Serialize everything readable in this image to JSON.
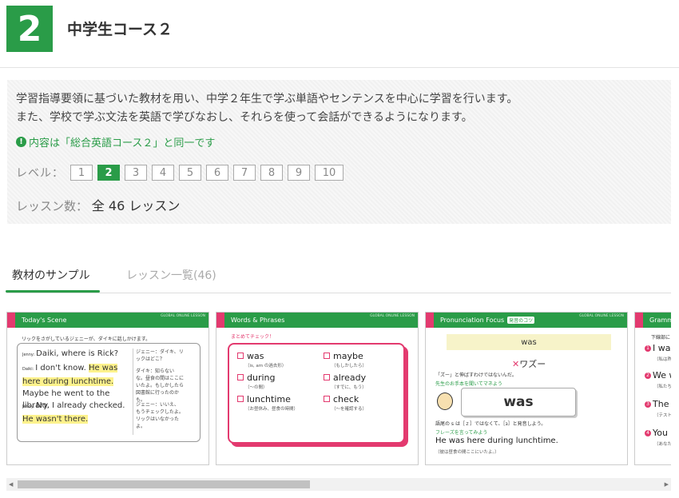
{
  "header": {
    "number": "2",
    "title": "中学生コース２"
  },
  "info": {
    "description_lines": [
      "学習指導要領に基づいた教材を用い、中学２年生で学ぶ単語やセンテンスを中心に学習を行います。",
      "また、学校で学ぶ文法を英語で学びなおし、それらを使って会話ができるようになります。"
    ],
    "note_icon": "!",
    "note": "内容は「総合英語コース２」と同一です",
    "level_label": "レベル：",
    "levels": [
      "1",
      "2",
      "3",
      "4",
      "5",
      "6",
      "7",
      "8",
      "9",
      "10"
    ],
    "active_level": "2",
    "lesson_label": "レッスン数：",
    "lesson_value": "全 46 レッスン"
  },
  "tabs": {
    "sample": "教材のサンプル",
    "list": "レッスン一覧(46)"
  },
  "cards": {
    "logo_text": "GLOBAL ONLINE LESSON",
    "scene": {
      "title": "Today's Scene",
      "hint": "リックをさがしているジェニーが、ダイキに話しかけます。",
      "speaker_jenny": "Jenny:",
      "speaker_daiki": "Daiki:",
      "line1": "Daiki, where is Rick?",
      "line2a": "I don't know.",
      "line2b": "He was here during lunchtime.",
      "line2c": "Maybe he went to the library.",
      "line3a": "No, I already checked.",
      "line3b": "He wasn't there.",
      "jp1_speaker": "ジェニー：",
      "jp1": "ダイキ、リックはどこ？",
      "jp2_speaker": "ダイキ：",
      "jp2": "知らないな。昼食の間はここにいたよ。もしかしたら図書館に行ったのかも。",
      "jp3_speaker": "ジェニー：",
      "jp3": "いいえ、もうチェックしたよ。リックはいなかったよ。"
    },
    "words": {
      "title": "Words & Phrases",
      "check": "まとめてチェック！",
      "items": [
        {
          "word": "was",
          "gloss": "（is, am の過去形）"
        },
        {
          "word": "maybe",
          "gloss": "（もしかしたら）"
        },
        {
          "word": "during",
          "gloss": "（〜の間）"
        },
        {
          "word": "already",
          "gloss": "（すでに、もう）"
        },
        {
          "word": "lunchtime",
          "gloss": "（お昼休み、昼食の時間）"
        },
        {
          "word": "check",
          "gloss": "（〜を確認する）"
        }
      ]
    },
    "pron": {
      "title": "Pronunciation Focus",
      "tag": "発音のコツ",
      "word": "was",
      "wrong": "ワズー",
      "tip1": "「ズー」と伸ばすわけではないんだ。",
      "tip_green": "先生のお手本を聞いてマネよう",
      "bubble": "was",
      "tip2": "語尾の s は［ｚ］ではなくて、［ɜ］と発音しよう。",
      "phrase_label": "フレーズを言ってみよう",
      "sentence": "He was here during lunchtime.",
      "sentence_jp": "（彼は昼食の間ここにいたよ。）"
    },
    "grammar": {
      "title": "Gramm",
      "hint": "下線部に",
      "items": [
        {
          "n": "1",
          "text": "I was",
          "jp": "（私は昨日"
        },
        {
          "n": "2",
          "text": "We w",
          "jp": "（私たちは"
        },
        {
          "n": "3",
          "text": "The t",
          "jp": "（テストは"
        },
        {
          "n": "4",
          "text": "You w",
          "jp": "（あなたは"
        }
      ]
    }
  }
}
